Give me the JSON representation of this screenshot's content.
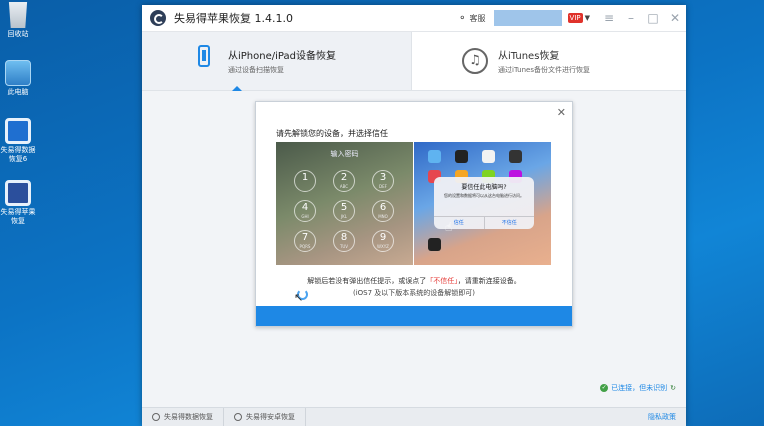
{
  "desktop": {
    "icons": [
      {
        "label": "回收站"
      },
      {
        "label": "此电脑"
      },
      {
        "label": "失易得数据恢复6"
      },
      {
        "label": "失易得苹果恢复"
      }
    ]
  },
  "window": {
    "title": "失易得苹果恢复  1.4.1.0",
    "service_label": "客服",
    "vip_badge": "VIP",
    "tabs": [
      {
        "title": "从iPhone/iPad设备恢复",
        "subtitle": "通过设备扫描恢复",
        "active": true
      },
      {
        "title": "从iTunes恢复",
        "subtitle": "通过iTunes备份文件进行恢复",
        "active": false
      }
    ]
  },
  "dialog": {
    "title": "请先解锁您的设备，并选择信任",
    "passcode_title": "输入密码",
    "keys": [
      {
        "num": "1",
        "letters": ""
      },
      {
        "num": "2",
        "letters": "ABC"
      },
      {
        "num": "3",
        "letters": "DEF"
      },
      {
        "num": "4",
        "letters": "GHI"
      },
      {
        "num": "5",
        "letters": "JKL"
      },
      {
        "num": "6",
        "letters": "MNO"
      },
      {
        "num": "7",
        "letters": "PQRS"
      },
      {
        "num": "8",
        "letters": "TUV"
      },
      {
        "num": "9",
        "letters": "WXYZ"
      }
    ],
    "trust_title": "要信任此电脑吗?",
    "trust_body": "您的设置和数据将可以从这台电脑进行访问。",
    "trust_button": "信任",
    "dont_trust_button": "不信任",
    "message_before": "解锁后若没有弹出信任提示，或误点了",
    "message_highlight": "「不信任」",
    "message_after": "，请重新连接设备。",
    "message_line2": "(iOS7 及以下版本系统的设备解锁即可)"
  },
  "status": {
    "text": "已连接，但未识别",
    "colors": {
      "ok": "#43a047",
      "link": "#1e88e5",
      "accent": "#1e88e5"
    }
  },
  "bottom_bar": {
    "items": [
      {
        "label": "失易得数据恢复"
      },
      {
        "label": "失易得安卓恢复"
      }
    ],
    "privacy": "隐私政策"
  }
}
